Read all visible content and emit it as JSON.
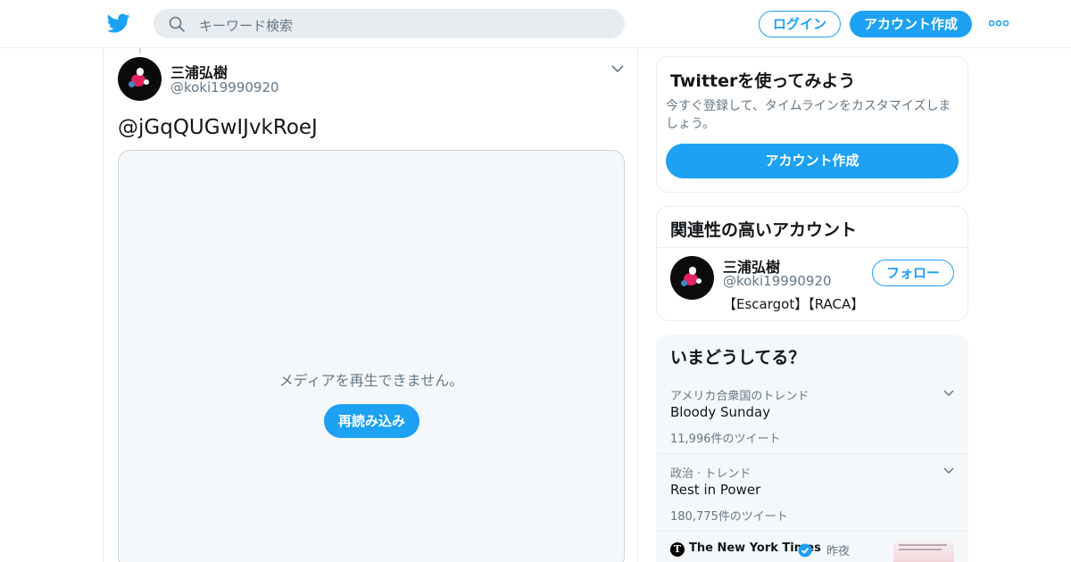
{
  "header": {
    "search_placeholder": "キーワード検索",
    "login_label": "ログイン",
    "signup_label": "アカウント作成"
  },
  "tweet": {
    "author_name": "三浦弘樹",
    "author_handle": "@koki19990920",
    "text": "@jGqQUGwIJvkRoeJ",
    "media": {
      "message": "メディアを再生できません。",
      "reload_label": "再読み込み"
    }
  },
  "sidebar": {
    "signup_card": {
      "title": "Twitterを使ってみよう",
      "description": "今すぐ登録して、タイムラインをカスタマイズしましょう。",
      "button_label": "アカウント作成"
    },
    "related": {
      "title": "関連性の高いアカウント",
      "account": {
        "name": "三浦弘樹",
        "handle": "@koki19990920",
        "bio": "【Escargot】【RACA】",
        "follow_label": "フォロー"
      }
    },
    "trends": {
      "title": "いまどうしてる？",
      "items": [
        {
          "context": "アメリカ合衆国のトレンド",
          "name": "Bloody Sunday",
          "count": "11,996件のツイート"
        },
        {
          "context": "政治 · トレンド",
          "name": "Rest in Power",
          "count": "180,775件のツイート"
        }
      ],
      "news": {
        "source": "The New York Times",
        "separator": "·",
        "time": "昨夜"
      }
    }
  },
  "colors": {
    "accent": "#1da1f2",
    "text_primary": "#14171a",
    "text_secondary": "#657786",
    "border": "#e6ecf0",
    "panel_bg": "#f5f8fa"
  },
  "icons": [
    "twitter-bird-icon",
    "search-icon",
    "more-dots-icon",
    "chevron-down-icon",
    "verified-badge-icon"
  ]
}
